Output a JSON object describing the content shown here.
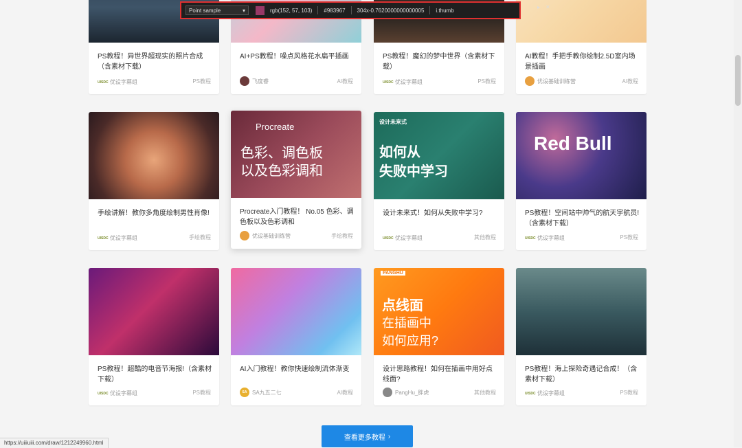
{
  "toolbar": {
    "mode": "Point sample",
    "rgb": "rgb(152, 57, 103)",
    "hex": "#983967",
    "zoom": "304x-0.7620000000000005",
    "target": "i.thumb",
    "swatch_color": "#983967"
  },
  "cards": [
    {
      "title": "PS教程！异世界超现实的照片合成（含素材下载）",
      "author": "优设字幕组",
      "category": "PS教程"
    },
    {
      "title": "AI+PS教程！噪点风格花水扁平插画",
      "author": "飞度睿",
      "category": "AI教程"
    },
    {
      "title": "PS教程！魔幻的梦中世界（含素材下载）",
      "author": "优设字幕组",
      "category": "PS教程"
    },
    {
      "title": "AI教程！手把手教你绘制2.5D室内场景插画",
      "author": "优设基础训练营",
      "category": "AI教程"
    },
    {
      "title": "手绘讲解！教你多角度绘制男性肖像!",
      "author": "优设字幕组",
      "category": "手绘教程"
    },
    {
      "title": "Procreate入门教程！ No.05 色彩、调色板以及色彩调和",
      "author": "优设基础训练营",
      "category": "手绘教程"
    },
    {
      "title": "设计未来式！如何从失败中学习?",
      "author": "优设字幕组",
      "category": "其他教程"
    },
    {
      "title": "PS教程！空间站中帅气的航天宇航员!（含素材下载）",
      "author": "优设字幕组",
      "category": "PS教程"
    },
    {
      "title": "PS教程！超酷的电音节海报!（含素材下载）",
      "author": "优设字幕组",
      "category": "PS教程"
    },
    {
      "title": "AI入门教程！教你快速绘制流体渐变",
      "author": "SA九五二七",
      "category": "AI教程"
    },
    {
      "title": "设计思路教程！如何在插画中用好点线面?",
      "author": "PangHu_胖虎",
      "category": "其他教程"
    },
    {
      "title": "PS教程！海上探险奇遇记合成！（含素材下载）",
      "author": "优设字幕组",
      "category": "PS教程"
    }
  ],
  "thumb_text": {
    "procreate_brand": "Procreate",
    "procreate_line1": "色彩、调色板",
    "procreate_line2": "以及色彩调和",
    "future_tag": "设计未来式",
    "future_line1": "如何从",
    "future_line2": "失败中学习",
    "redbull": "Red Bull",
    "panghu_tag": "PANGHU",
    "panghu_line1": "点线面",
    "panghu_line2": "在插画中",
    "panghu_line3": "如何应用?"
  },
  "more_button": "查看更多教程",
  "status_url": "https://uiiiuiii.com/draw/1212249960.html"
}
